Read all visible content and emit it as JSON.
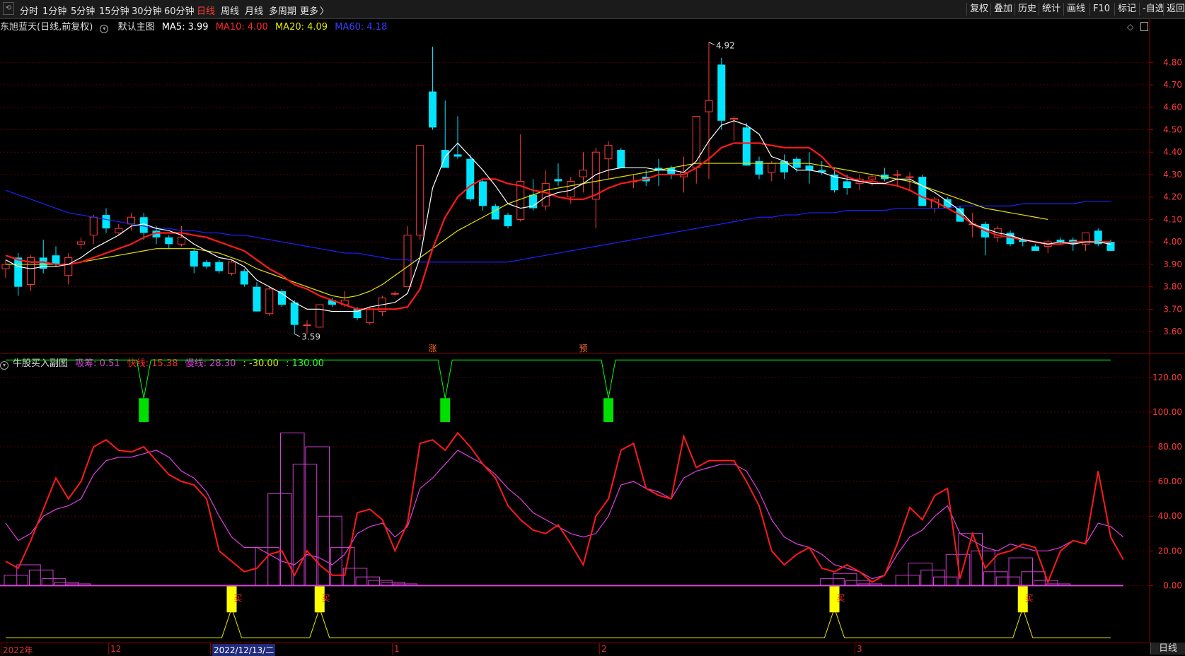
{
  "toolbar": {
    "back_icon": "back-arrow-icon",
    "periods": [
      "分时",
      "1分钟",
      "5分钟",
      "15分钟",
      "30分钟",
      "60分钟",
      "日线",
      "周线",
      "月线",
      "多周期",
      "更多"
    ],
    "active_period": "日线",
    "more_arrow": "〉",
    "right_buttons": [
      "复权",
      "叠加",
      "历史",
      "统计",
      "画线",
      "F10",
      "标记",
      "-自选",
      "返回"
    ]
  },
  "main_chart": {
    "title": "东旭蓝天(日线,前复权)",
    "formula": "默认主图",
    "ma5": "MA5: 3.99",
    "ma10": "MA10: 4.00",
    "ma20": "MA20: 4.09",
    "ma60": "MA60: 4.18",
    "high_label": "4.92",
    "low_label": "3.59",
    "y_ticks": [
      "4.80",
      "4.70",
      "4.60",
      "4.50",
      "4.40",
      "4.30",
      "4.20",
      "4.10",
      "4.00",
      "3.90",
      "3.80",
      "3.70",
      "3.60"
    ],
    "y_range": [
      3.55,
      4.93
    ],
    "marker_zhang": "涨",
    "marker_yu": "预",
    "colors": {
      "up": "#ff3b3b",
      "down": "#00e5ff",
      "ma5": "#ffffff",
      "ma10": "#ff1a1a",
      "ma20": "#e6e600",
      "ma60": "#2020ff"
    }
  },
  "sub_chart": {
    "title": "牛股买入副图",
    "xichou": "吸筹: 0.51",
    "kuaixian": "快线: 15.38",
    "manxian": "慢线: 28.30",
    "v1": ": -30.00",
    "v2": ": 130.00",
    "y_ticks": [
      "120.00",
      "100.00",
      "80.00",
      "60.00",
      "40.00",
      "20.00",
      "0.00"
    ],
    "y_range": [
      -32,
      135
    ],
    "buy_label": "买",
    "colors": {
      "fast": "#ff1a1a",
      "slow": "#e040e0",
      "top": "#00ff00",
      "bottom": "#e6e600"
    }
  },
  "x_axis": {
    "labels": [
      "2022年",
      "12",
      "2022/12/13/二",
      "1",
      "2",
      "3"
    ],
    "period_label": "日线"
  },
  "chart_data": [
    {
      "type": "candlestick",
      "title": "东旭蓝天(日线,前复权)",
      "ylim": [
        3.55,
        4.93
      ],
      "candles": [
        [
          3.88,
          3.92,
          3.84,
          3.9
        ],
        [
          3.93,
          3.95,
          3.76,
          3.8
        ],
        [
          3.81,
          3.94,
          3.78,
          3.93
        ],
        [
          3.93,
          4.01,
          3.86,
          3.88
        ],
        [
          3.94,
          3.98,
          3.89,
          3.9
        ],
        [
          3.85,
          3.95,
          3.81,
          3.93
        ],
        [
          3.99,
          4.02,
          3.97,
          4.0
        ],
        [
          4.03,
          4.12,
          3.99,
          4.11
        ],
        [
          4.12,
          4.15,
          4.04,
          4.06
        ],
        [
          4.04,
          4.08,
          4.03,
          4.06
        ],
        [
          4.08,
          4.13,
          4.05,
          4.11
        ],
        [
          4.11,
          4.13,
          4.01,
          4.04
        ],
        [
          4.05,
          4.07,
          3.99,
          4.02
        ],
        [
          4.02,
          4.03,
          3.97,
          3.99
        ],
        [
          3.99,
          4.07,
          3.98,
          4.02
        ],
        [
          3.96,
          3.97,
          3.86,
          3.89
        ],
        [
          3.91,
          3.92,
          3.88,
          3.89
        ],
        [
          3.91,
          3.92,
          3.86,
          3.87
        ],
        [
          3.86,
          3.92,
          3.85,
          3.91
        ],
        [
          3.87,
          3.88,
          3.8,
          3.81
        ],
        [
          3.8,
          3.82,
          3.69,
          3.69
        ],
        [
          3.68,
          3.8,
          3.67,
          3.79
        ],
        [
          3.78,
          3.79,
          3.71,
          3.72
        ],
        [
          3.73,
          3.74,
          3.59,
          3.63
        ],
        [
          3.63,
          3.65,
          3.59,
          3.63
        ],
        [
          3.62,
          3.72,
          3.62,
          3.72
        ],
        [
          3.74,
          3.75,
          3.71,
          3.72
        ],
        [
          3.72,
          3.78,
          3.71,
          3.74
        ],
        [
          3.7,
          3.71,
          3.65,
          3.66
        ],
        [
          3.64,
          3.71,
          3.63,
          3.7
        ],
        [
          3.69,
          3.76,
          3.67,
          3.75
        ],
        [
          3.77,
          3.78,
          3.76,
          3.77
        ],
        [
          3.8,
          4.07,
          3.8,
          4.03
        ],
        [
          4.03,
          4.43,
          4.01,
          4.43
        ],
        [
          4.67,
          4.87,
          4.5,
          4.51
        ],
        [
          4.41,
          4.63,
          4.33,
          4.33
        ],
        [
          4.39,
          4.56,
          4.37,
          4.38
        ],
        [
          4.37,
          4.39,
          4.18,
          4.19
        ],
        [
          4.27,
          4.28,
          4.14,
          4.16
        ],
        [
          4.16,
          4.17,
          4.1,
          4.1
        ],
        [
          4.12,
          4.13,
          4.06,
          4.07
        ],
        [
          4.1,
          4.48,
          4.09,
          4.27
        ],
        [
          4.21,
          4.28,
          4.14,
          4.15
        ],
        [
          4.16,
          4.32,
          4.14,
          4.26
        ],
        [
          4.28,
          4.35,
          4.25,
          4.27
        ],
        [
          4.2,
          4.29,
          4.17,
          4.27
        ],
        [
          4.29,
          4.4,
          4.22,
          4.32
        ],
        [
          4.19,
          4.42,
          4.06,
          4.4
        ],
        [
          4.37,
          4.45,
          4.28,
          4.43
        ],
        [
          4.41,
          4.42,
          4.33,
          4.33
        ],
        [
          4.27,
          4.3,
          4.24,
          4.27
        ],
        [
          4.29,
          4.32,
          4.25,
          4.27
        ],
        [
          4.33,
          4.37,
          4.25,
          4.32
        ],
        [
          4.33,
          4.34,
          4.28,
          4.3
        ],
        [
          4.29,
          4.38,
          4.22,
          4.31
        ],
        [
          4.33,
          4.56,
          4.26,
          4.56
        ],
        [
          4.58,
          4.89,
          4.28,
          4.63
        ],
        [
          4.79,
          4.82,
          4.5,
          4.54
        ],
        [
          4.55,
          4.56,
          4.45,
          4.55
        ],
        [
          4.51,
          4.53,
          4.34,
          4.34
        ],
        [
          4.36,
          4.38,
          4.28,
          4.3
        ],
        [
          4.31,
          4.36,
          4.27,
          4.35
        ],
        [
          4.36,
          4.39,
          4.28,
          4.31
        ],
        [
          4.37,
          4.38,
          4.31,
          4.33
        ],
        [
          4.34,
          4.4,
          4.26,
          4.32
        ],
        [
          4.32,
          4.36,
          4.3,
          4.31
        ],
        [
          4.3,
          4.33,
          4.22,
          4.23
        ],
        [
          4.27,
          4.3,
          4.21,
          4.24
        ],
        [
          4.26,
          4.3,
          4.23,
          4.28
        ],
        [
          4.28,
          4.3,
          4.25,
          4.29
        ],
        [
          4.3,
          4.33,
          4.27,
          4.28
        ],
        [
          4.3,
          4.32,
          4.25,
          4.3
        ],
        [
          4.29,
          4.31,
          4.23,
          4.29
        ],
        [
          4.29,
          4.3,
          4.16,
          4.16
        ],
        [
          4.15,
          4.2,
          4.13,
          4.19
        ],
        [
          4.19,
          4.2,
          4.15,
          4.15
        ],
        [
          4.15,
          4.16,
          4.09,
          4.09
        ],
        [
          4.08,
          4.13,
          4.02,
          4.08
        ],
        [
          4.08,
          4.09,
          3.94,
          4.02
        ],
        [
          4.02,
          4.07,
          4.0,
          4.06
        ],
        [
          4.04,
          4.05,
          3.98,
          3.99
        ],
        [
          4.01,
          4.02,
          3.98,
          4.0
        ],
        [
          3.98,
          3.99,
          3.96,
          3.96
        ],
        [
          3.98,
          4.01,
          3.95,
          4.0
        ],
        [
          4.01,
          4.02,
          3.99,
          4.0
        ],
        [
          4.01,
          4.02,
          3.96,
          3.99
        ],
        [
          3.99,
          4.04,
          3.96,
          4.04
        ],
        [
          4.05,
          4.06,
          3.98,
          3.99
        ],
        [
          4.0,
          4.01,
          3.96,
          3.96
        ]
      ],
      "ma5": [
        3.92,
        3.89,
        3.88,
        3.89,
        3.89,
        3.9,
        3.93,
        3.97,
        4.0,
        4.03,
        4.07,
        4.08,
        4.06,
        4.05,
        4.03,
        3.99,
        3.96,
        3.93,
        3.92,
        3.89,
        3.83,
        3.8,
        3.77,
        3.73,
        3.7,
        3.7,
        3.69,
        3.69,
        3.69,
        3.71,
        3.72,
        3.73,
        3.77,
        3.93,
        4.24,
        4.38,
        4.44,
        4.38,
        4.32,
        4.25,
        4.17,
        4.15,
        4.16,
        4.2,
        4.22,
        4.23,
        4.26,
        4.3,
        4.32,
        4.33,
        4.33,
        4.33,
        4.32,
        4.32,
        4.31,
        4.36,
        4.45,
        4.52,
        4.54,
        4.52,
        4.48,
        4.38,
        4.36,
        4.32,
        4.32,
        4.31,
        4.29,
        4.28,
        4.27,
        4.26,
        4.26,
        4.28,
        4.28,
        4.25,
        4.22,
        4.18,
        4.14,
        4.08,
        4.06,
        4.04,
        4.03,
        4.01,
        4.0,
        3.99,
        4.0,
        3.99,
        4.0,
        4.0,
        3.99
      ],
      "ma10": [
        3.94,
        3.92,
        3.91,
        3.91,
        3.9,
        3.9,
        3.91,
        3.93,
        3.95,
        3.97,
        3.99,
        4.02,
        4.04,
        4.04,
        4.04,
        4.03,
        4.02,
        4.0,
        3.98,
        3.96,
        3.92,
        3.88,
        3.85,
        3.81,
        3.79,
        3.76,
        3.74,
        3.72,
        3.7,
        3.7,
        3.7,
        3.7,
        3.71,
        3.79,
        3.97,
        4.11,
        4.2,
        4.25,
        4.28,
        4.28,
        4.26,
        4.25,
        4.23,
        4.22,
        4.2,
        4.19,
        4.19,
        4.21,
        4.24,
        4.26,
        4.27,
        4.28,
        4.3,
        4.3,
        4.3,
        4.33,
        4.37,
        4.42,
        4.44,
        4.44,
        4.44,
        4.43,
        4.42,
        4.42,
        4.42,
        4.38,
        4.32,
        4.29,
        4.27,
        4.27,
        4.26,
        4.25,
        4.23,
        4.2,
        4.18,
        4.15,
        4.12,
        4.08,
        4.05,
        4.03,
        4.02,
        4.01,
        4.0,
        3.99,
        3.99,
        4.0,
        4.0,
        4.0,
        4.0
      ],
      "ma20": [
        3.9,
        3.9,
        3.9,
        3.9,
        3.9,
        3.9,
        3.91,
        3.92,
        3.93,
        3.94,
        3.95,
        3.96,
        3.97,
        3.97,
        3.97,
        3.97,
        3.96,
        3.95,
        3.93,
        3.91,
        3.88,
        3.86,
        3.84,
        3.82,
        3.8,
        3.78,
        3.76,
        3.75,
        3.76,
        3.78,
        3.81,
        3.85,
        3.89,
        3.93,
        3.97,
        4.01,
        4.05,
        4.08,
        4.11,
        4.14,
        4.17,
        4.19,
        4.21,
        4.23,
        4.24,
        4.25,
        4.26,
        4.27,
        4.28,
        4.29,
        4.3,
        4.31,
        4.32,
        4.33,
        4.34,
        4.35,
        4.35,
        4.35,
        4.35,
        4.35,
        4.35,
        4.35,
        4.35,
        4.35,
        4.35,
        4.34,
        4.33,
        4.32,
        4.31,
        4.3,
        4.29,
        4.28,
        4.27,
        4.25,
        4.23,
        4.21,
        4.19,
        4.17,
        4.15,
        4.14,
        4.13,
        4.12,
        4.11,
        4.1
      ],
      "ma60": [
        4.23,
        4.21,
        4.19,
        4.17,
        4.15,
        4.13,
        4.12,
        4.11,
        4.1,
        4.09,
        4.08,
        4.07,
        4.06,
        4.06,
        4.05,
        4.05,
        4.04,
        4.04,
        4.03,
        4.03,
        4.02,
        4.01,
        4.0,
        3.99,
        3.98,
        3.97,
        3.96,
        3.95,
        3.95,
        3.94,
        3.93,
        3.92,
        3.92,
        3.91,
        3.91,
        3.91,
        3.91,
        3.91,
        3.91,
        3.91,
        3.91,
        3.92,
        3.93,
        3.94,
        3.95,
        3.96,
        3.97,
        3.98,
        3.99,
        4.0,
        4.01,
        4.02,
        4.03,
        4.04,
        4.05,
        4.06,
        4.07,
        4.08,
        4.09,
        4.1,
        4.11,
        4.11,
        4.12,
        4.12,
        4.13,
        4.13,
        4.13,
        4.14,
        4.14,
        4.14,
        4.14,
        4.15,
        4.15,
        4.15,
        4.15,
        4.15,
        4.16,
        4.16,
        4.16,
        4.16,
        4.16,
        4.17,
        4.17,
        4.17,
        4.17,
        4.17,
        4.18,
        4.18,
        4.18
      ]
    },
    {
      "type": "line",
      "title": "牛股买入副图",
      "ylim": [
        -32,
        135
      ],
      "series": [
        {
          "name": "快线",
          "values": [
            14,
            10,
            26,
            44,
            62,
            50,
            60,
            80,
            84,
            78,
            77,
            80,
            72,
            64,
            60,
            58,
            50,
            20,
            14,
            8,
            10,
            18,
            20,
            6,
            20,
            12,
            6,
            6,
            42,
            44,
            38,
            20,
            36,
            82,
            84,
            78,
            88,
            80,
            70,
            62,
            46,
            38,
            32,
            30,
            35,
            24,
            12,
            40,
            50,
            78,
            82,
            56,
            52,
            50,
            86,
            68,
            72,
            72,
            72,
            60,
            46,
            20,
            12,
            18,
            22,
            10,
            8,
            12,
            8,
            2,
            6,
            24,
            45,
            38,
            52,
            56,
            4,
            30,
            10,
            18,
            20,
            24,
            22,
            2,
            20,
            26,
            24,
            66,
            28,
            15
          ]
        },
        {
          "name": "慢线",
          "values": [
            36,
            26,
            30,
            40,
            44,
            46,
            50,
            64,
            72,
            74,
            74,
            76,
            78,
            74,
            66,
            62,
            54,
            40,
            28,
            22,
            22,
            18,
            14,
            12,
            18,
            16,
            12,
            18,
            30,
            34,
            36,
            28,
            34,
            56,
            62,
            70,
            78,
            74,
            70,
            64,
            56,
            50,
            42,
            38,
            34,
            30,
            28,
            30,
            40,
            58,
            60,
            56,
            54,
            50,
            62,
            66,
            68,
            70,
            70,
            66,
            54,
            38,
            28,
            24,
            22,
            18,
            12,
            10,
            8,
            4,
            6,
            18,
            28,
            32,
            40,
            46,
            30,
            26,
            22,
            20,
            24,
            22,
            20,
            20,
            22,
            26,
            24,
            36,
            34,
            28
          ]
        },
        {
          "name": "吸筹",
          "values": [
            6,
            12,
            9,
            4,
            2,
            1,
            0,
            0,
            0,
            0,
            0,
            0,
            0,
            0,
            0,
            0,
            0,
            0,
            0,
            0,
            22,
            53,
            88,
            70,
            80,
            40,
            22,
            10,
            5,
            3,
            2,
            1,
            0,
            0,
            0,
            0,
            0,
            0,
            0,
            0,
            0,
            0,
            0,
            0,
            0,
            0,
            0,
            0,
            0,
            0,
            0,
            0,
            0,
            0,
            0,
            0,
            0,
            0,
            0,
            0,
            0,
            0,
            0,
            0,
            0,
            4,
            7,
            3,
            1,
            0,
            0,
            6,
            13,
            9,
            5,
            18,
            30,
            20,
            8,
            5,
            16,
            8,
            3,
            1,
            0
          ]
        }
      ],
      "top_markers_x": [
        11,
        35,
        48
      ],
      "buy_markers_x": [
        18,
        25,
        66,
        81
      ]
    }
  ]
}
